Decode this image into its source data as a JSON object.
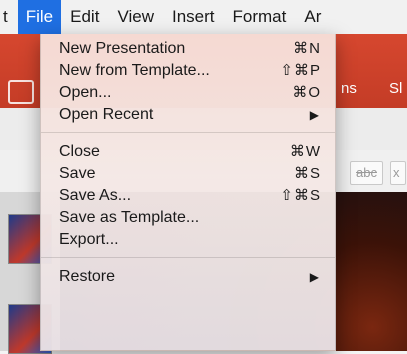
{
  "menubar": {
    "items": [
      {
        "label": "t"
      },
      {
        "label": "File"
      },
      {
        "label": "Edit"
      },
      {
        "label": "View"
      },
      {
        "label": "Insert"
      },
      {
        "label": "Format"
      },
      {
        "label": "Ar"
      }
    ]
  },
  "background": {
    "ribbon_tabs": [
      "ns",
      "Sl"
    ],
    "format_buttons": [
      "abc",
      "x"
    ]
  },
  "file_menu": {
    "groups": [
      [
        {
          "label": "New Presentation",
          "shortcut": "⌘N"
        },
        {
          "label": "New from Template...",
          "shortcut": "⇧⌘P"
        },
        {
          "label": "Open...",
          "shortcut": "⌘O"
        },
        {
          "label": "Open Recent",
          "submenu": "▶"
        }
      ],
      [
        {
          "label": "Close",
          "shortcut": "⌘W"
        },
        {
          "label": "Save",
          "shortcut": "⌘S"
        },
        {
          "label": "Save As...",
          "shortcut": "⇧⌘S"
        },
        {
          "label": "Save as Template..."
        },
        {
          "label": "Export..."
        }
      ],
      [
        {
          "label": "Restore",
          "submenu": "▶"
        }
      ]
    ]
  },
  "colors": {
    "menubar_highlight": "#1f6fe2",
    "ribbon": "#c43c26"
  }
}
